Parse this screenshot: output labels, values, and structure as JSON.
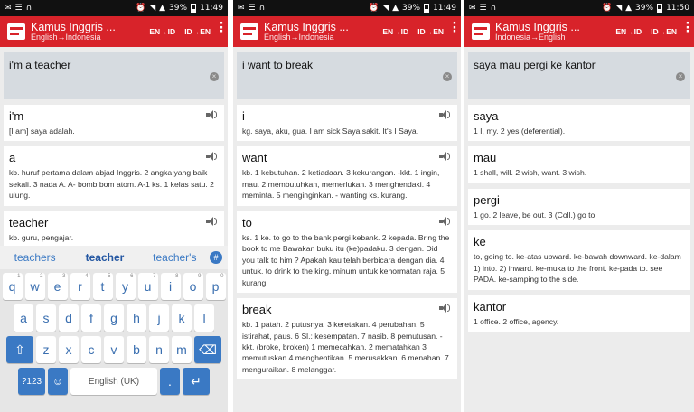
{
  "status": {
    "battery": "39%",
    "times": [
      "11:49",
      "11:49",
      "11:50"
    ]
  },
  "app": {
    "title": "Kamus Inggris ...",
    "tab_en_id": "EN→ID",
    "tab_id_en": "ID→EN",
    "menu_glyph": "⋮"
  },
  "screens": [
    {
      "direction": "English→Indonesia",
      "query_prefix": "i'm a ",
      "query_underlined": "teacher",
      "entries": [
        {
          "word": "i'm",
          "def": "[I am] saya adalah."
        },
        {
          "word": "a",
          "def": "kb. huruf pertama dalam abjad Inggris. 2 angka yang baik sekali. 3 nada A. A- bomb bom atom. A-1 ks. 1 kelas satu. 2 ulung."
        },
        {
          "word": "teacher",
          "def": "kb. guru, pengajar."
        }
      ],
      "suggestions": [
        "teachers",
        "teacher",
        "teacher's"
      ]
    },
    {
      "direction": "English→Indonesia",
      "query": "i want to break",
      "entries": [
        {
          "word": "i",
          "def": "kg. saya, aku, gua. I am sick Saya sakit. It's I Saya."
        },
        {
          "word": "want",
          "def": "kb. 1 kebutuhan. 2 ketiadaan. 3 kekurangan. -kkt. 1 ingin, mau. 2 membutuhkan, memerlukan. 3 menghendaki. 4 meminta. 5 menginginkan. - wanting ks. kurang."
        },
        {
          "word": "to",
          "def": "ks. 1 ke. to go to the bank pergi kebank. 2 kepada. Bring the book to me Bawakan buku itu (ke)padaku. 3 dengan. Did you talk to him ? Apakah kau telah berbicara dengan dia. 4 untuk. to drink to the king. minum untuk kehormatan raja. 5 kurang."
        },
        {
          "word": "break",
          "def": "kb. 1 patah. 2 putusnya. 3 keretakan. 4 perubahan. 5 istirahat, paus. 6 Sl.: kesempatan. 7 nasib. 8 pemutusan. -kkt. (broke, broken) 1 memecahkan. 2 mematahkan 3 memutuskan 4 menghentikan. 5 merusakkan. 6 menahan. 7 menguraikan. 8 melanggar."
        }
      ]
    },
    {
      "direction": "Indonesia→English",
      "query": "saya mau pergi ke kantor",
      "entries": [
        {
          "word": "saya",
          "def": "1 I, my. 2 yes (deferential)."
        },
        {
          "word": "mau",
          "def": "1 shall, will. 2 wish, want. 3 wish."
        },
        {
          "word": "pergi",
          "def": "1 go. 2 leave, be out. 3 (Coll.) go to."
        },
        {
          "word": "ke",
          "def": "to, going to. ke-atas upward. ke-bawah downward. ke-dalam 1) into. 2) inward. ke-muka to the front. ke-pada to. see PADA. ke-samping to the side."
        },
        {
          "word": "kantor",
          "def": "1 office. 2 office, agency."
        }
      ]
    }
  ],
  "keyboard": {
    "row1": [
      "q",
      "w",
      "e",
      "r",
      "t",
      "y",
      "u",
      "i",
      "o",
      "p"
    ],
    "row1_alt": [
      "1",
      "2",
      "3",
      "4",
      "5",
      "6",
      "7",
      "8",
      "9",
      "0"
    ],
    "row2": [
      "a",
      "s",
      "d",
      "f",
      "g",
      "h",
      "j",
      "k",
      "l"
    ],
    "row3": [
      "z",
      "x",
      "c",
      "v",
      "b",
      "n",
      "m"
    ],
    "num_label": "?123",
    "space_label": "English (UK)",
    "dot_label": ".",
    "shift_glyph": "⇧",
    "del_glyph": "⌫",
    "enter_glyph": "↵",
    "emoji_glyph": "☺"
  },
  "colors": {
    "appbar": "#d8232a",
    "key_accent": "#3a79c4"
  }
}
